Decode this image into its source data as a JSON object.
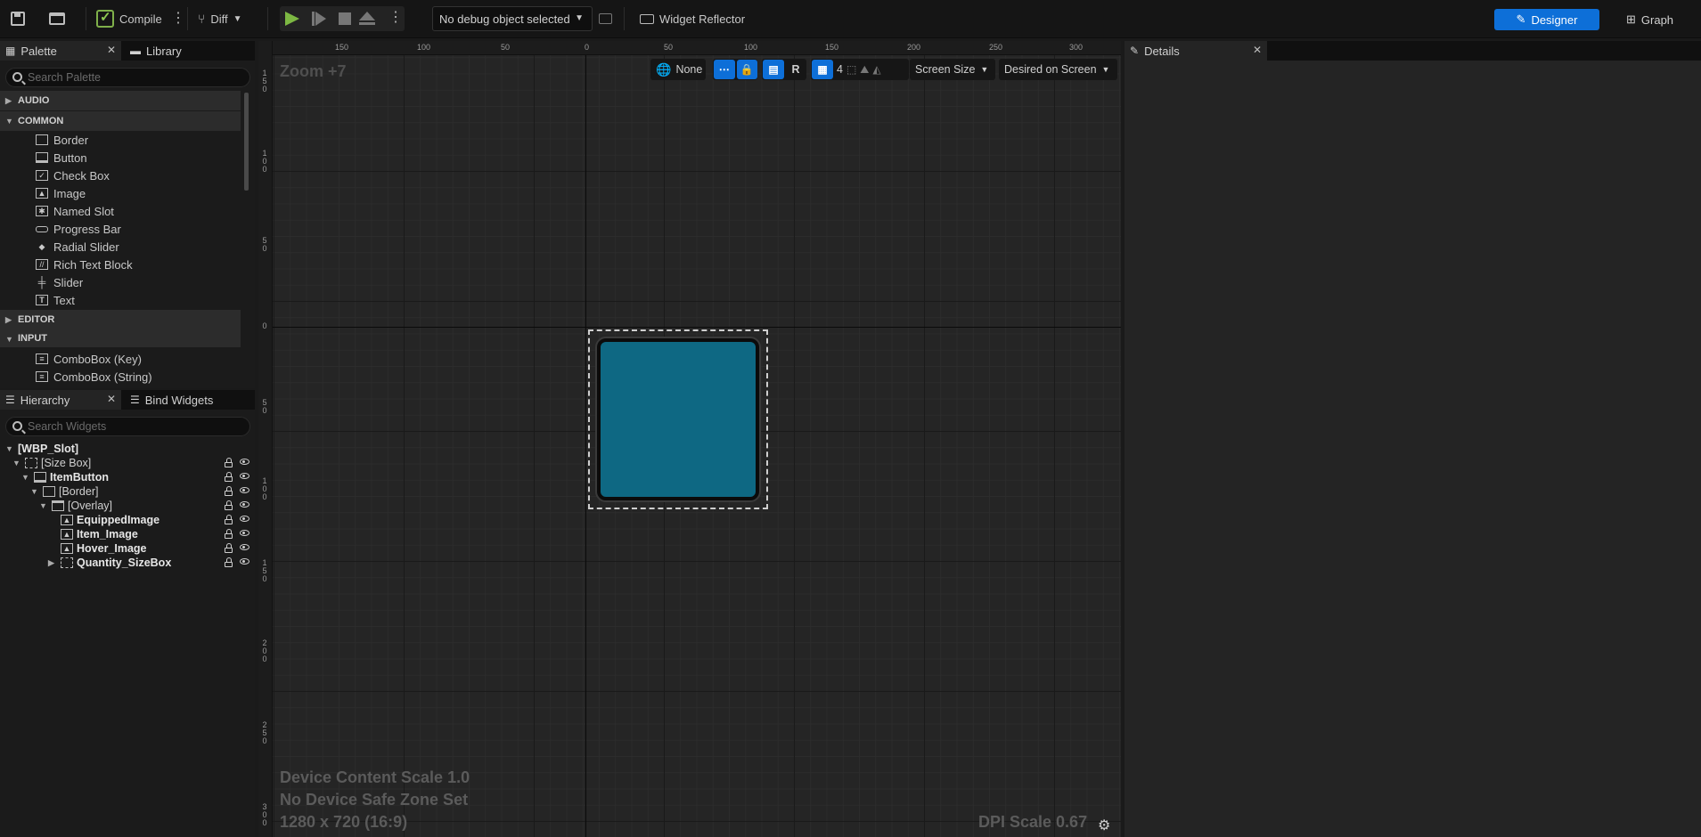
{
  "toolbar": {
    "compile_label": "Compile",
    "diff_label": "Diff",
    "debug_object": "No debug object selected",
    "widget_reflector_label": "Widget Reflector",
    "designer_label": "Designer",
    "graph_label": "Graph",
    "accent_color": "#0d6fd8"
  },
  "palette": {
    "tab_label": "Palette",
    "library_tab_label": "Library",
    "search_placeholder": "Search Palette",
    "categories": [
      {
        "name": "AUDIO",
        "expanded": false
      },
      {
        "name": "COMMON",
        "expanded": true
      },
      {
        "name": "EDITOR",
        "expanded": false
      },
      {
        "name": "INPUT",
        "expanded": true
      }
    ],
    "common_items": [
      "Border",
      "Button",
      "Check Box",
      "Image",
      "Named Slot",
      "Progress Bar",
      "Radial Slider",
      "Rich Text Block",
      "Slider",
      "Text"
    ],
    "input_items": [
      "ComboBox (Key)",
      "ComboBox (String)"
    ]
  },
  "hierarchy": {
    "tab_label": "Hierarchy",
    "bind_tab_label": "Bind Widgets",
    "search_placeholder": "Search Widgets",
    "nodes": [
      {
        "label": "[WBP_Slot]",
        "bold": true
      },
      {
        "label": "[Size Box]",
        "bold": false
      },
      {
        "label": "ItemButton",
        "bold": true
      },
      {
        "label": "[Border]",
        "bold": false
      },
      {
        "label": "[Overlay]",
        "bold": false
      },
      {
        "label": "EquippedImage",
        "bold": true
      },
      {
        "label": "Item_Image",
        "bold": true
      },
      {
        "label": "Hover_Image",
        "bold": true
      },
      {
        "label": "Quantity_SizeBox",
        "bold": true
      }
    ]
  },
  "canvas": {
    "zoom_label": "Zoom +7",
    "localization_value": "None",
    "rotate_label": "R",
    "grid_snap_value": "4",
    "screen_size_label": "Screen Size",
    "fill_mode_label": "Desired on Screen",
    "device_content_scale": "Device Content Scale 1.0",
    "safe_zone": "No Device Safe Zone Set",
    "resolution": "1280 x 720 (16:9)",
    "dpi_scale": "DPI Scale 0.67",
    "top_ruler_labels": [
      "150",
      "100",
      "50",
      "0",
      "50",
      "100",
      "150",
      "200",
      "250",
      "300"
    ],
    "left_ruler_labels": [
      "150",
      "100",
      "50",
      "0",
      "50",
      "100",
      "150",
      "200",
      "250",
      "300"
    ],
    "widget_color": "#0e6883"
  },
  "details": {
    "tab_label": "Details"
  }
}
